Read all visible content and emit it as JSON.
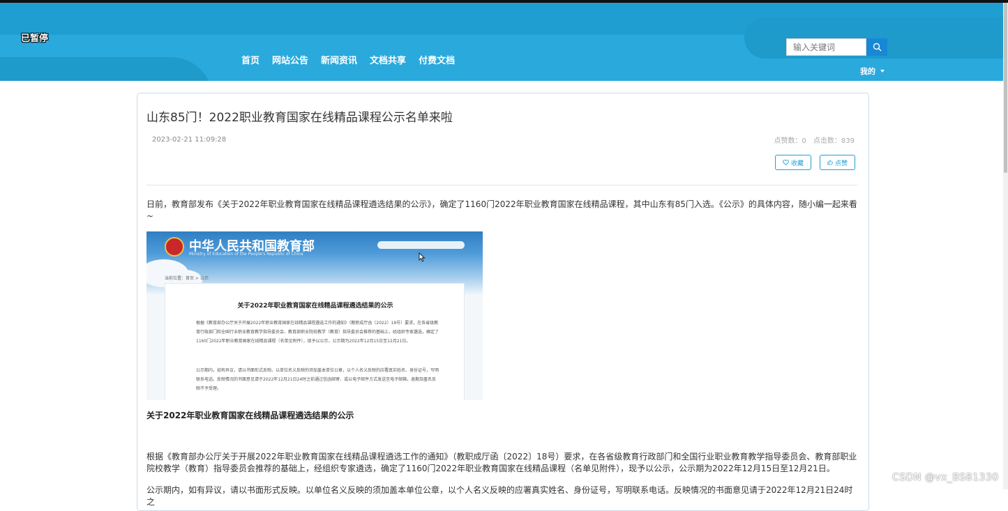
{
  "overlay": {
    "paused_label": "已暂停"
  },
  "nav": {
    "items": [
      {
        "label": "首页"
      },
      {
        "label": "网站公告"
      },
      {
        "label": "新闻资讯"
      },
      {
        "label": "文档共享"
      },
      {
        "label": "付费文档"
      }
    ]
  },
  "search": {
    "placeholder": "输入关键词",
    "icon": "search-icon"
  },
  "user_menu": {
    "label": "我的",
    "icon": "caret-down-icon"
  },
  "article": {
    "title": "山东85门！2022职业教育国家在线精品课程公示名单来啦",
    "date": "2023-02-21 11:09:28",
    "likes_label": "点赞数：0",
    "clicks_label": "点击数：839",
    "favorite_label": "收藏",
    "favorite_icon": "heart-icon",
    "like_label": "点赞",
    "like_icon": "thumbs-up-icon",
    "intro": "日前，教育部发布《关于2022年职业教育国家在线精品课程遴选结果的公示》，确定了1160门2022年职业教育国家在线精品课程，其中山东有85门入选。《公示》的具体内容，随小编一起来看~",
    "embedded_image": {
      "ministry_cn": "中华人民共和国教育部",
      "ministry_en": "Ministry of Education of the People's Republic of China",
      "breadcrumb": "当前位置：首页 > 公示",
      "doc_title": "关于2022年职业教育国家在线精品课程遴选结果的公示",
      "doc_para1": "根据《教育部办公厅关于开展2022年职业教育国家在线精品课程遴选工作的通知》（教职成厅函〔2022〕18号）要求，在各省级教育行政部门和全国行业职业教育教学指导委员会、教育部职业院校教学（教育）指导委员会推荐的基础上，经组织专家遴选，确定了1160门2022年职业教育国家在线精品课程（名单见附件），现予以公示，公示期为2022年12月15日至12月21日。",
      "doc_para2": "公示期内，如有异议，请以书面形式反映。以单位名义反映的须加盖本单位公章，以个人名义反映的应署真实姓名、身份证号，写明联系电话。反映情况的书面意见请于2022年12月21日24时之前通过信函邮寄、或以电子邮件方式发送至电子邮箱，逾期及匿名反映不予受理。"
    },
    "section_heading": "关于2022年职业教育国家在线精品课程遴选结果的公示",
    "para2": "根据《教育部办公厅关于开展2022年职业教育国家在线精品课程遴选工作的通知》（教职成厅函〔2022〕18号）要求，在各省级教育行政部门和全国行业职业教育教学指导委员会、教育部职业院校教学（教育）指导委员会推荐的基础上，经组织专家遴选，确定了1160门2022年职业教育国家在线精品课程（名单见附件），现予以公示，公示期为2022年12月15日至12月21日。",
    "para3": "公示期内，如有异议，请以书面形式反映。以单位名义反映的须加盖本单位公章，以个人名义反映的应署真实姓名、身份证号，写明联系电话。反映情况的书面意见请于2022年12月21日24时之"
  },
  "watermark": {
    "text": "CSDN @vx_BS81330"
  },
  "colors": {
    "header": "#1f9fd1",
    "accent": "#1e9fd5",
    "search_button": "#1788d6"
  }
}
